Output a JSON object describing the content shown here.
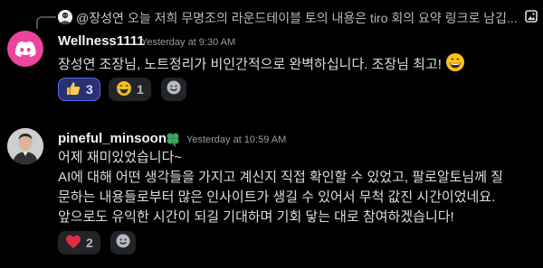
{
  "reply": {
    "author": "@장성연",
    "preview": "오늘 저희 무명조의 라운드테이블 토의 내용은 tiro 회의 요약 링크로 남깁..."
  },
  "messages": [
    {
      "username": "Wellness1111",
      "timestamp": "Yesterday at 9:30 AM",
      "lines": [
        "장성연 조장님, 노트정리가 비인간적으로 완벽하십니다. 조장님 최고!"
      ],
      "reactions": [
        {
          "emoji": "thumbs-up",
          "count": "3",
          "active": true
        },
        {
          "emoji": "joy",
          "count": "1",
          "active": false
        }
      ]
    },
    {
      "username": "pineful_minsoon",
      "timestamp": "Yesterday at 10:59 AM",
      "lines": [
        "어제 재미있었습니다~",
        "AI에 대해 어떤 생각들을 가지고 계신지 직접 확인할 수 있었고, 팔로알토님께 질",
        "문하는 내용들로부터 많은 인사이트가 생길 수 있어서 무척 값진 시간이었네요.",
        "앞으로도 유익한 시간이 되길 기대하며 기회 닿는 대로 참여하겠습니다!"
      ],
      "reactions": [
        {
          "emoji": "red-heart",
          "count": "2",
          "active": false
        }
      ]
    }
  ],
  "colors": {
    "discord_brand": "#eb459e",
    "role_icon": "#3ba55c",
    "active_reaction_border": "#5865f2"
  }
}
